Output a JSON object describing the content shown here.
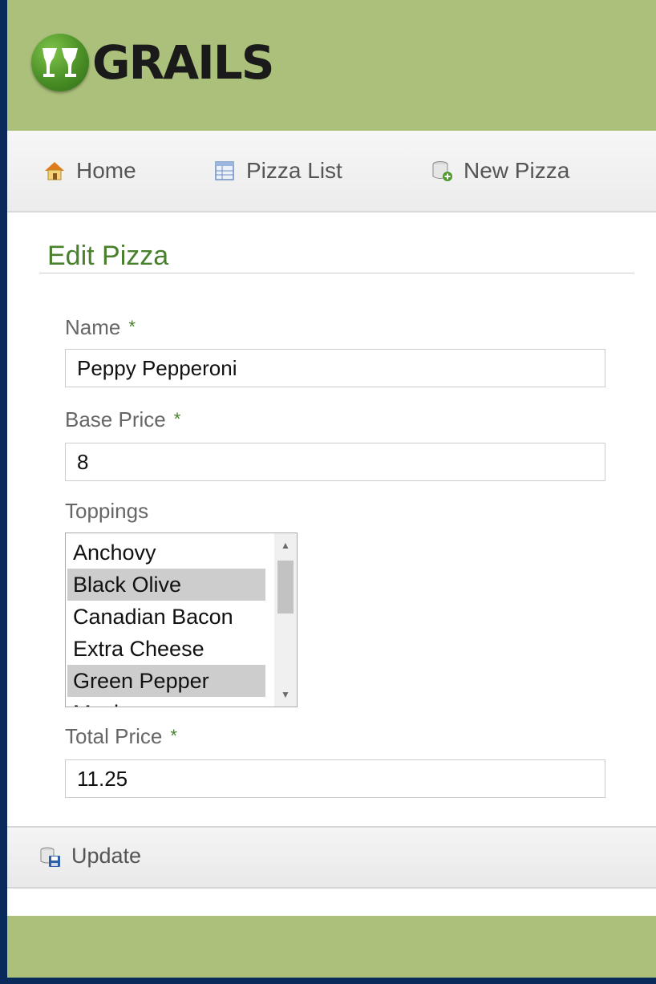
{
  "app": {
    "logo_text": "GRAILS",
    "accent_color": "#abc07a",
    "title_color": "#48802c"
  },
  "nav": {
    "home_label": "Home",
    "home_icon": "house-icon",
    "list_label": "Pizza List",
    "list_icon": "list-icon",
    "new_label": "New Pizza",
    "new_icon": "new-record-icon"
  },
  "page": {
    "title": "Edit Pizza"
  },
  "form": {
    "name": {
      "label": "Name",
      "required_mark": "*",
      "value": "Peppy Pepperoni"
    },
    "base_price": {
      "label": "Base Price",
      "required_mark": "*",
      "value": "8"
    },
    "toppings": {
      "label": "Toppings",
      "options": [
        {
          "label": "Anchovy",
          "selected": false
        },
        {
          "label": "Black Olive",
          "selected": true
        },
        {
          "label": "Canadian Bacon",
          "selected": false
        },
        {
          "label": "Extra Cheese",
          "selected": false
        },
        {
          "label": "Green Pepper",
          "selected": true
        },
        {
          "label": "Mushroom",
          "selected": false
        }
      ]
    },
    "total_price": {
      "label": "Total Price",
      "required_mark": "*",
      "value": "11.25"
    }
  },
  "actions": {
    "update_label": "Update",
    "update_icon": "save-icon"
  }
}
